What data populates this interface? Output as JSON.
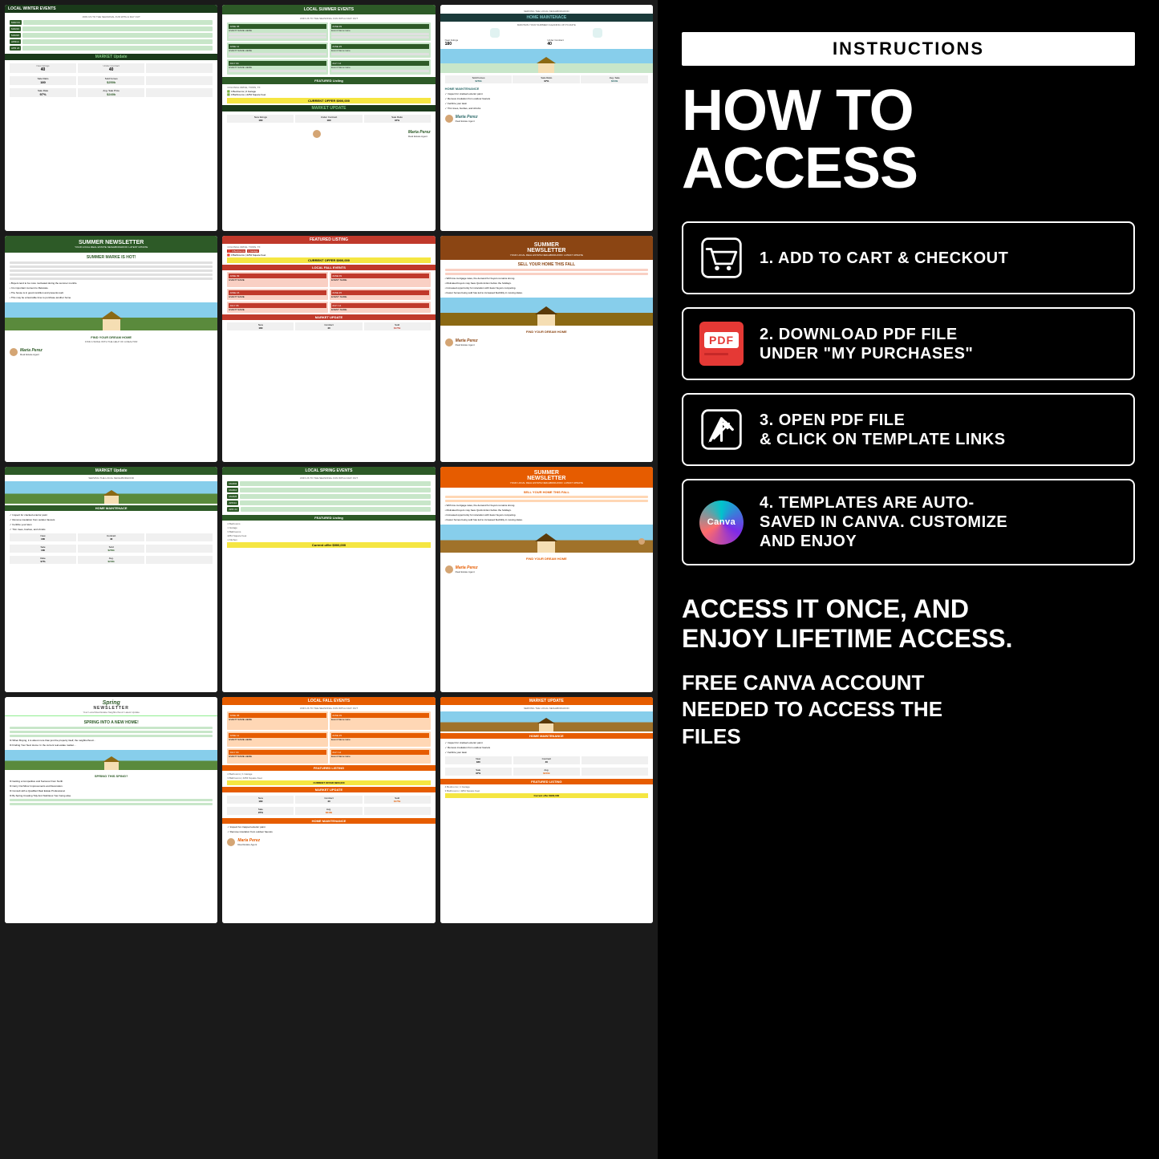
{
  "leftPanel": {
    "cards": [
      {
        "type": "winter-events",
        "color": "green"
      },
      {
        "type": "summer-events",
        "color": "green"
      },
      {
        "type": "home-maintenance-market",
        "color": "teal"
      },
      {
        "type": "newsletter-summer",
        "color": "green"
      },
      {
        "type": "fall-events-listing",
        "color": "orange"
      },
      {
        "type": "fall-newsletter",
        "color": "orange"
      },
      {
        "type": "market-update-small",
        "color": "green"
      },
      {
        "type": "spring-local-events",
        "color": "green"
      },
      {
        "type": "fall-newsletter2",
        "color": "autumn"
      },
      {
        "type": "spring-newsletter",
        "color": "spring"
      },
      {
        "type": "local-fall-events2",
        "color": "orange"
      },
      {
        "type": "blank",
        "color": "white"
      }
    ]
  },
  "rightPanel": {
    "headerLabel": "INSTRUCTIONS",
    "mainTitle": "HOW TO\nACCESS",
    "steps": [
      {
        "id": 1,
        "icon": "cart",
        "text": "1. ADD TO CART & CHECKOUT"
      },
      {
        "id": 2,
        "icon": "pdf",
        "text": "2. DOWNLOAD PDF FILE\nUNDER \"MY PURCHASES\""
      },
      {
        "id": 3,
        "icon": "arrow",
        "text": "3. OPEN PDF FILE\n& CLICK ON TEMPLATE LINKS"
      },
      {
        "id": 4,
        "icon": "canva",
        "text": "4. TEMPLATES ARE AUTO-\nSAVED IN CANVA. CUSTOMIZE\nAND ENJOY"
      }
    ],
    "lifetimeText": "ACCESS IT ONCE, AND\nENJOY LIFETIME ACCESS.",
    "canvaNote": "FREE CANVA ACCOUNT\nNEEDED TO ACCESS THE\nFILES"
  }
}
